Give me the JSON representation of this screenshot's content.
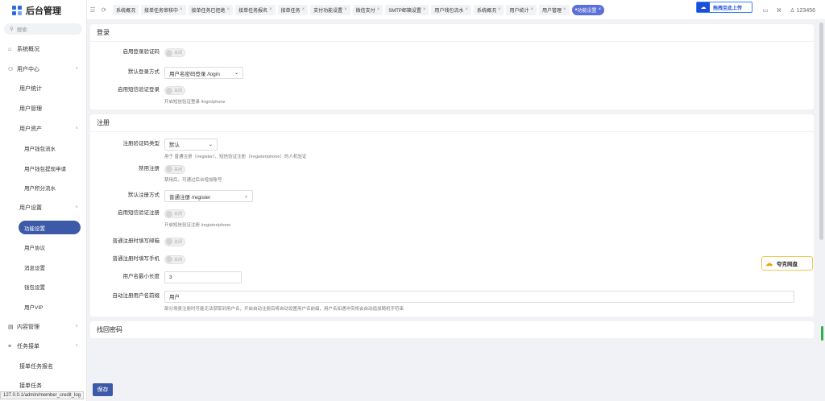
{
  "app": {
    "title": "后台管理"
  },
  "sidebar": {
    "search_placeholder": "搜索",
    "items": [
      {
        "label": "系统概况",
        "icon": "home-icon",
        "level": 1
      },
      {
        "label": "用户中心",
        "icon": "users-icon",
        "level": 1,
        "expanded": true
      },
      {
        "label": "用户统计",
        "level": 2
      },
      {
        "label": "用户管理",
        "level": 2
      },
      {
        "label": "用户资产",
        "level": 2,
        "expanded": true
      },
      {
        "label": "用户钱包流水",
        "level": 3
      },
      {
        "label": "用户钱包提现申请",
        "level": 3
      },
      {
        "label": "用户积分流水",
        "level": 3
      },
      {
        "label": "用户设置",
        "level": 2,
        "expanded": true
      },
      {
        "label": "功能设置",
        "level": 3,
        "active": true
      },
      {
        "label": "用户协议",
        "level": 3
      },
      {
        "label": "消息设置",
        "level": 3
      },
      {
        "label": "钱包设置",
        "level": 3
      },
      {
        "label": "用户VIP",
        "level": 3
      },
      {
        "label": "内容管理",
        "icon": "document-icon",
        "level": 1
      },
      {
        "label": "任务接单",
        "icon": "list-icon",
        "level": 1,
        "expanded": true
      },
      {
        "label": "接单任务报名",
        "level": 2
      },
      {
        "label": "接单任务",
        "level": 2
      }
    ]
  },
  "tabs": [
    {
      "label": "系统概况",
      "closable": false
    },
    {
      "label": "接单任务审核中",
      "closable": true
    },
    {
      "label": "接单任务已拒绝",
      "closable": true
    },
    {
      "label": "接单任务报名",
      "closable": true
    },
    {
      "label": "接单任务",
      "closable": true
    },
    {
      "label": "支付功能设置",
      "closable": true
    },
    {
      "label": "微信支付",
      "closable": true
    },
    {
      "label": "SMTP邮箱设置",
      "closable": true
    },
    {
      "label": "用户钱包流水",
      "closable": true
    },
    {
      "label": "系统概况",
      "closable": true
    },
    {
      "label": "用户统计",
      "closable": true
    },
    {
      "label": "用户管理",
      "closable": true
    },
    {
      "label": "功能设置",
      "closable": true,
      "active": true
    }
  ],
  "topbar": {
    "upload_label": "拖拽至此上传",
    "username": "123456"
  },
  "login": {
    "title": "登录",
    "captcha_label": "启用登录验证码",
    "captcha_state": "关闭",
    "default_method_label": "默认登录方式",
    "default_method_value": "用户名密码登录 /login",
    "sms_login_label": "启用短信验证登录",
    "sms_login_state": "关闭",
    "sms_login_help": "开启短信验证登录 /login/phone"
  },
  "register": {
    "title": "注册",
    "captcha_type_label": "注册验证码类型",
    "captcha_type_value": "默认",
    "captcha_type_help": "用于 普通注册（/register）、短信验证注册（/register/phone）的人机验证",
    "disable_label": "禁用注册",
    "disable_state": "关闭",
    "disable_help": "禁用后，可通过后台增加账号",
    "default_method_label": "默认注册方式",
    "default_method_value": "普通注册 /register",
    "sms_label": "启用短信验证注册",
    "sms_state": "关闭",
    "sms_help": "开启短信验证注册 /register/phone",
    "email_label": "普通注册时填写邮箱",
    "email_state": "关闭",
    "phone_label": "普通注册时填写手机",
    "phone_state": "关闭",
    "min_len_label": "用户名最小长度",
    "min_len_value": "3",
    "prefix_label": "自动注册用户名前缀",
    "prefix_value": "用户",
    "prefix_help": "部分场景注册时可能无法获取到用户名，开启自动注册后将自动设置用户名前缀，用户名如遇冲突将会自动追加随机字符串"
  },
  "reset": {
    "title": "找回密码"
  },
  "actions": {
    "save_label": "保存"
  },
  "status_url": "127.0.0.1/admin/member_credit_log",
  "float_widget": {
    "label": "夸克网盘"
  },
  "colors": {
    "primary": "#3d5aa8",
    "tab_active": "#5b6fd8",
    "brand_blue": "#2f6bdb"
  }
}
